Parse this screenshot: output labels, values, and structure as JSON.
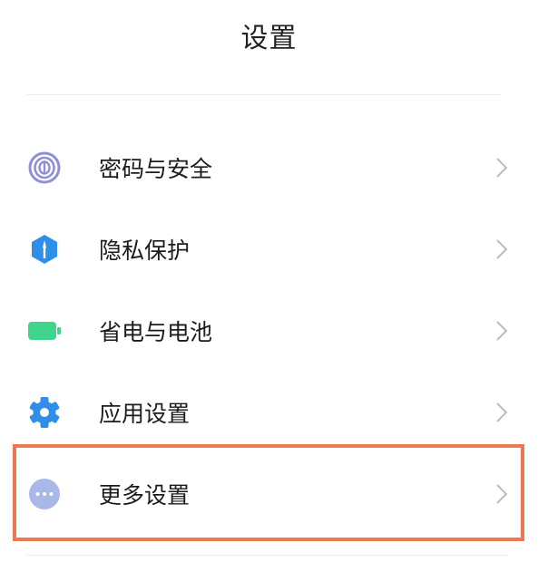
{
  "header": {
    "title": "设置"
  },
  "colors": {
    "highlight": "#ee7a52",
    "fingerprint_icon": "#8e8fd6",
    "privacy_icon": "#2f8fe8",
    "battery_icon": "#3dd68c",
    "app_settings_icon": "#2f8fe8",
    "more_icon": "#a9b8e6",
    "chevron": "#bdbdbd"
  },
  "settings": {
    "items": [
      {
        "label": "密码与安全",
        "icon": "fingerprint-icon"
      },
      {
        "label": "隐私保护",
        "icon": "privacy-shield-icon"
      },
      {
        "label": "省电与电池",
        "icon": "battery-icon"
      },
      {
        "label": "应用设置",
        "icon": "gear-icon"
      },
      {
        "label": "更多设置",
        "icon": "more-dots-icon"
      }
    ]
  }
}
